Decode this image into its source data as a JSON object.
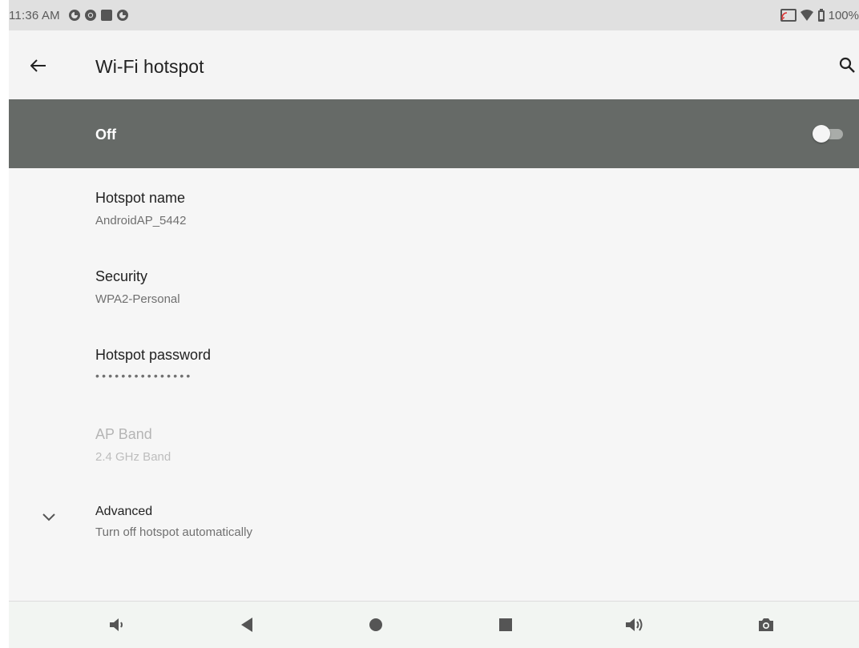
{
  "status_bar": {
    "time": "11:36 AM",
    "notification_icons": [
      "app-icon",
      "chrome-icon",
      "stop-icon",
      "app-icon"
    ],
    "battery_text": "100%"
  },
  "app_bar": {
    "title": "Wi-Fi hotspot",
    "back_icon": "arrow-back-icon",
    "search_icon": "search-icon"
  },
  "master_switch": {
    "label": "Off",
    "enabled": false
  },
  "settings": {
    "hotspot_name": {
      "title": "Hotspot name",
      "summary": "AndroidAP_5442"
    },
    "security": {
      "title": "Security",
      "summary": "WPA2-Personal"
    },
    "password": {
      "title": "Hotspot password",
      "summary": "•••••••••••••••"
    },
    "ap_band": {
      "title": "AP Band",
      "summary": "2.4 GHz Band",
      "disabled": true
    },
    "advanced": {
      "title": "Advanced",
      "summary": "Turn off hotspot automatically"
    }
  },
  "nav_bar": {
    "buttons": [
      "volume-down-icon",
      "back-icon",
      "home-icon",
      "recents-icon",
      "volume-up-icon",
      "screenshot-icon"
    ]
  },
  "colors": {
    "master_bar": "#666a67",
    "background": "#f6f6f6",
    "status_bar": "#e0e0e0"
  }
}
